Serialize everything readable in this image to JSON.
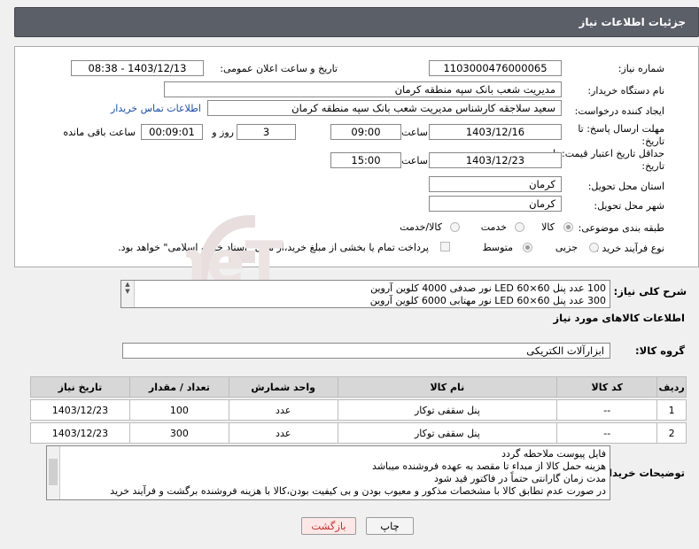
{
  "header": {
    "title": "جزئیات اطلاعات نیاز"
  },
  "form": {
    "need_number_label": "شماره نیاز:",
    "need_number": "1103000476000065",
    "announce_label": "تاریخ و ساعت اعلان عمومی:",
    "announce_value": "1403/12/13 - 08:38",
    "buyer_label": "نام دستگاه خریدار:",
    "buyer_value": "مدیریت شعب بانک سپه منطقه کرمان",
    "creator_label": "ایجاد کننده درخواست:",
    "creator_value": "سعید سلاجقه کارشناس مدیریت شعب بانک سپه منطقه کرمان",
    "contact_link": "اطلاعات تماس خریدار",
    "deadline_label": "مهلت ارسال پاسخ: تا",
    "deadline_label2": "تاریخ:",
    "deadline_date": "1403/12/16",
    "time_label": "ساعت",
    "deadline_time": "09:00",
    "days_value": "3",
    "days_label": "روز و",
    "remaining_value": "00:09:01",
    "remaining_label": "ساعت باقی مانده",
    "validity_label": "حداقل تاریخ اعتبار قیمت: تا",
    "validity_label2": "تاریخ:",
    "validity_date": "1403/12/23",
    "validity_time": "15:00",
    "province_label": "استان محل تحویل:",
    "province_value": "کرمان",
    "city_label": "شهر محل تحویل:",
    "city_value": "کرمان",
    "category_label": "طبقه بندی موضوعی:",
    "category_options": [
      "کالا",
      "خدمت",
      "کالا/خدمت"
    ],
    "category_selected": "کالا",
    "process_label": "نوع فرآیند خرید :",
    "process_options": [
      "جزیی",
      "متوسط"
    ],
    "process_selected": "متوسط",
    "payment_note": "پرداخت تمام یا بخشی از مبلغ خرید،از محل \"اسناد خزانه اسلامی\" خواهد بود."
  },
  "summary": {
    "label": "شرح کلی نیاز:",
    "lines": [
      "100 عدد پنل 60×60 LED نور صدفی 4000 کلوین آروین",
      "300 عدد پنل 60×60 LED نور مهتابی 6000 کلوین آروین"
    ]
  },
  "goods": {
    "section_title": "اطلاعات کالاهای مورد نیاز",
    "group_label": "گروه کالا:",
    "group_value": "ابزارآلات الکتریکی",
    "columns": [
      "ردیف",
      "کد کالا",
      "نام کالا",
      "واحد شمارش",
      "تعداد / مقدار",
      "تاریخ نیاز"
    ],
    "rows": [
      {
        "idx": "1",
        "code": "--",
        "name": "پنل سقفی توکار",
        "unit": "عدد",
        "qty": "100",
        "date": "1403/12/23"
      },
      {
        "idx": "2",
        "code": "--",
        "name": "پنل سقفی توکار",
        "unit": "عدد",
        "qty": "300",
        "date": "1403/12/23"
      }
    ]
  },
  "buyer_notes": {
    "label": "توضیحات خریدار:",
    "lines": [
      "فایل پیوست ملاحظه گردد",
      "هزینه حمل کالا از مبداء تا مقصد به عهده فروشنده میباشد",
      "مدت زمان گارانتی حتماً در فاکتور قید شود",
      "در صورت عدم تطابق کالا با مشخصات مذکور و معیوب بودن و بی کیفیت بودن،کالا با هزینه فروشنده برگشت و فرآیند خرید"
    ]
  },
  "buttons": {
    "print": "چاپ",
    "back": "بازگشت"
  },
  "watermark": {
    "text": "AriaTender.neT"
  },
  "colors": {
    "header_bg": "#5a5f68",
    "link": "#1a4ea3",
    "back_btn_bg": "#fde7e7",
    "back_btn_text": "#c03030"
  }
}
